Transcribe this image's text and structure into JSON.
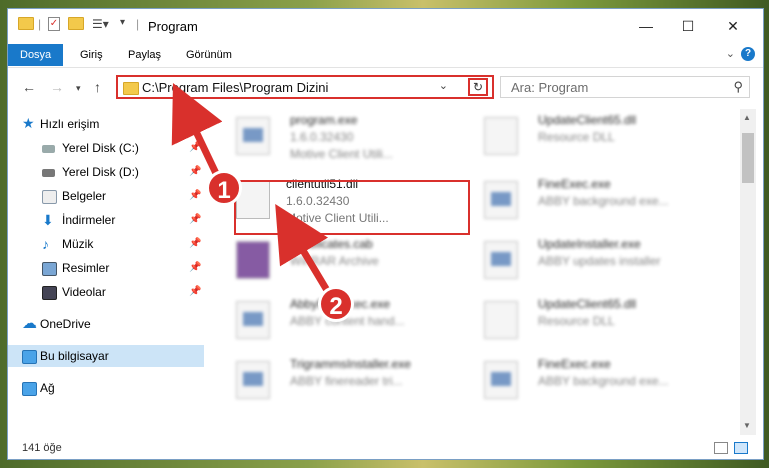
{
  "window": {
    "title": "Program"
  },
  "ribbon": {
    "tabs": [
      "Dosya",
      "Giriş",
      "Paylaş",
      "Görünüm"
    ]
  },
  "address": {
    "path": "C:\\Program Files\\Program Dizini"
  },
  "search": {
    "placeholder": "Ara: Program"
  },
  "nav": {
    "items": [
      {
        "label": "Hızlı erişim"
      },
      {
        "label": "Yerel Disk (C:)"
      },
      {
        "label": "Yerel Disk (D:)"
      },
      {
        "label": "Belgeler"
      },
      {
        "label": "İndirmeler"
      },
      {
        "label": "Müzik"
      },
      {
        "label": "Resimler"
      },
      {
        "label": "Videolar"
      },
      {
        "label": "OneDrive"
      },
      {
        "label": "Bu bilgisayar"
      },
      {
        "label": "Ağ"
      }
    ]
  },
  "files": [
    {
      "name": "program.exe",
      "version": "1.6.0.32430",
      "description": "Motive Client Utili..."
    },
    {
      "name": "UpdateClient65.dll",
      "version": "",
      "description": "Resource DLL"
    },
    {
      "name": "clientutil51.dll",
      "version": "1.6.0.32430",
      "description": "Motive Client Utili..."
    },
    {
      "name": "FineExec.exe",
      "version": "",
      "description": "ABBY background exe..."
    },
    {
      "name": "Certificates.cab",
      "version": "",
      "description": "WinRAR Archive"
    },
    {
      "name": "UpdateInstaller.exe",
      "version": "",
      "description": "ABBY updates installer"
    },
    {
      "name": "AbbyFineExec.exe",
      "version": "",
      "description": "ABBY content hand..."
    },
    {
      "name": "UpdateClient65.dll",
      "version": "",
      "description": "Resource DLL"
    },
    {
      "name": "TrigrammsInstaller.exe",
      "version": "",
      "description": "ABBY finereader tri..."
    },
    {
      "name": "FineExec.exe",
      "version": "",
      "description": "ABBY background exe..."
    }
  ],
  "status": {
    "count": "141 öğe"
  },
  "badges": [
    "1",
    "2"
  ],
  "colors": {
    "accent": "#1979ca",
    "highlight": "#d9302c"
  }
}
